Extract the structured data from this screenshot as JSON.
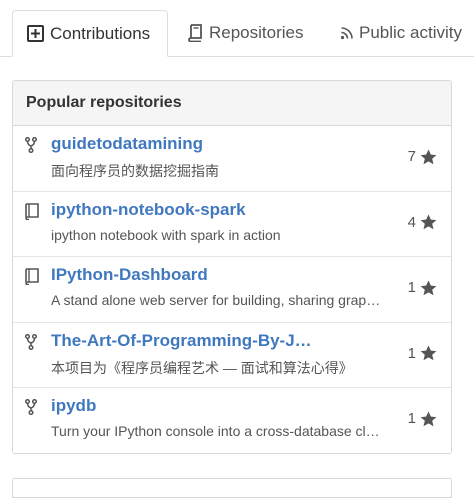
{
  "tabs": [
    {
      "label": "Contributions",
      "icon": "plus-square-icon",
      "selected": true
    },
    {
      "label": "Repositories",
      "icon": "book-icon",
      "selected": false
    },
    {
      "label": "Public activity",
      "icon": "rss-icon",
      "selected": false
    }
  ],
  "popular": {
    "heading": "Popular repositories",
    "repos": [
      {
        "name": "guidetodatamining",
        "description": "面向程序员的数据挖掘指南",
        "stars": "7",
        "icon": "fork-icon"
      },
      {
        "name": "ipython-notebook-spark",
        "description": "ipython notebook with spark in action",
        "stars": "4",
        "icon": "repo-book-icon"
      },
      {
        "name": "IPython-Dashboard",
        "description": "A stand alone web server for building, sharing graphs created in ipython. Build fast and share easily",
        "stars": "1",
        "icon": "repo-book-icon"
      },
      {
        "name": "The-Art-Of-Programming-By-J…",
        "description": "本项目为《程序员编程艺术 — 面试和算法心得》",
        "stars": "1",
        "icon": "fork-icon"
      },
      {
        "name": "ipydb",
        "description": "Turn your IPython console into a cross-database client",
        "stars": "1",
        "icon": "fork-icon"
      }
    ]
  },
  "colors": {
    "link": "#4078c0",
    "header_bg": "#f5f5f5",
    "border": "#d8d8d8"
  }
}
